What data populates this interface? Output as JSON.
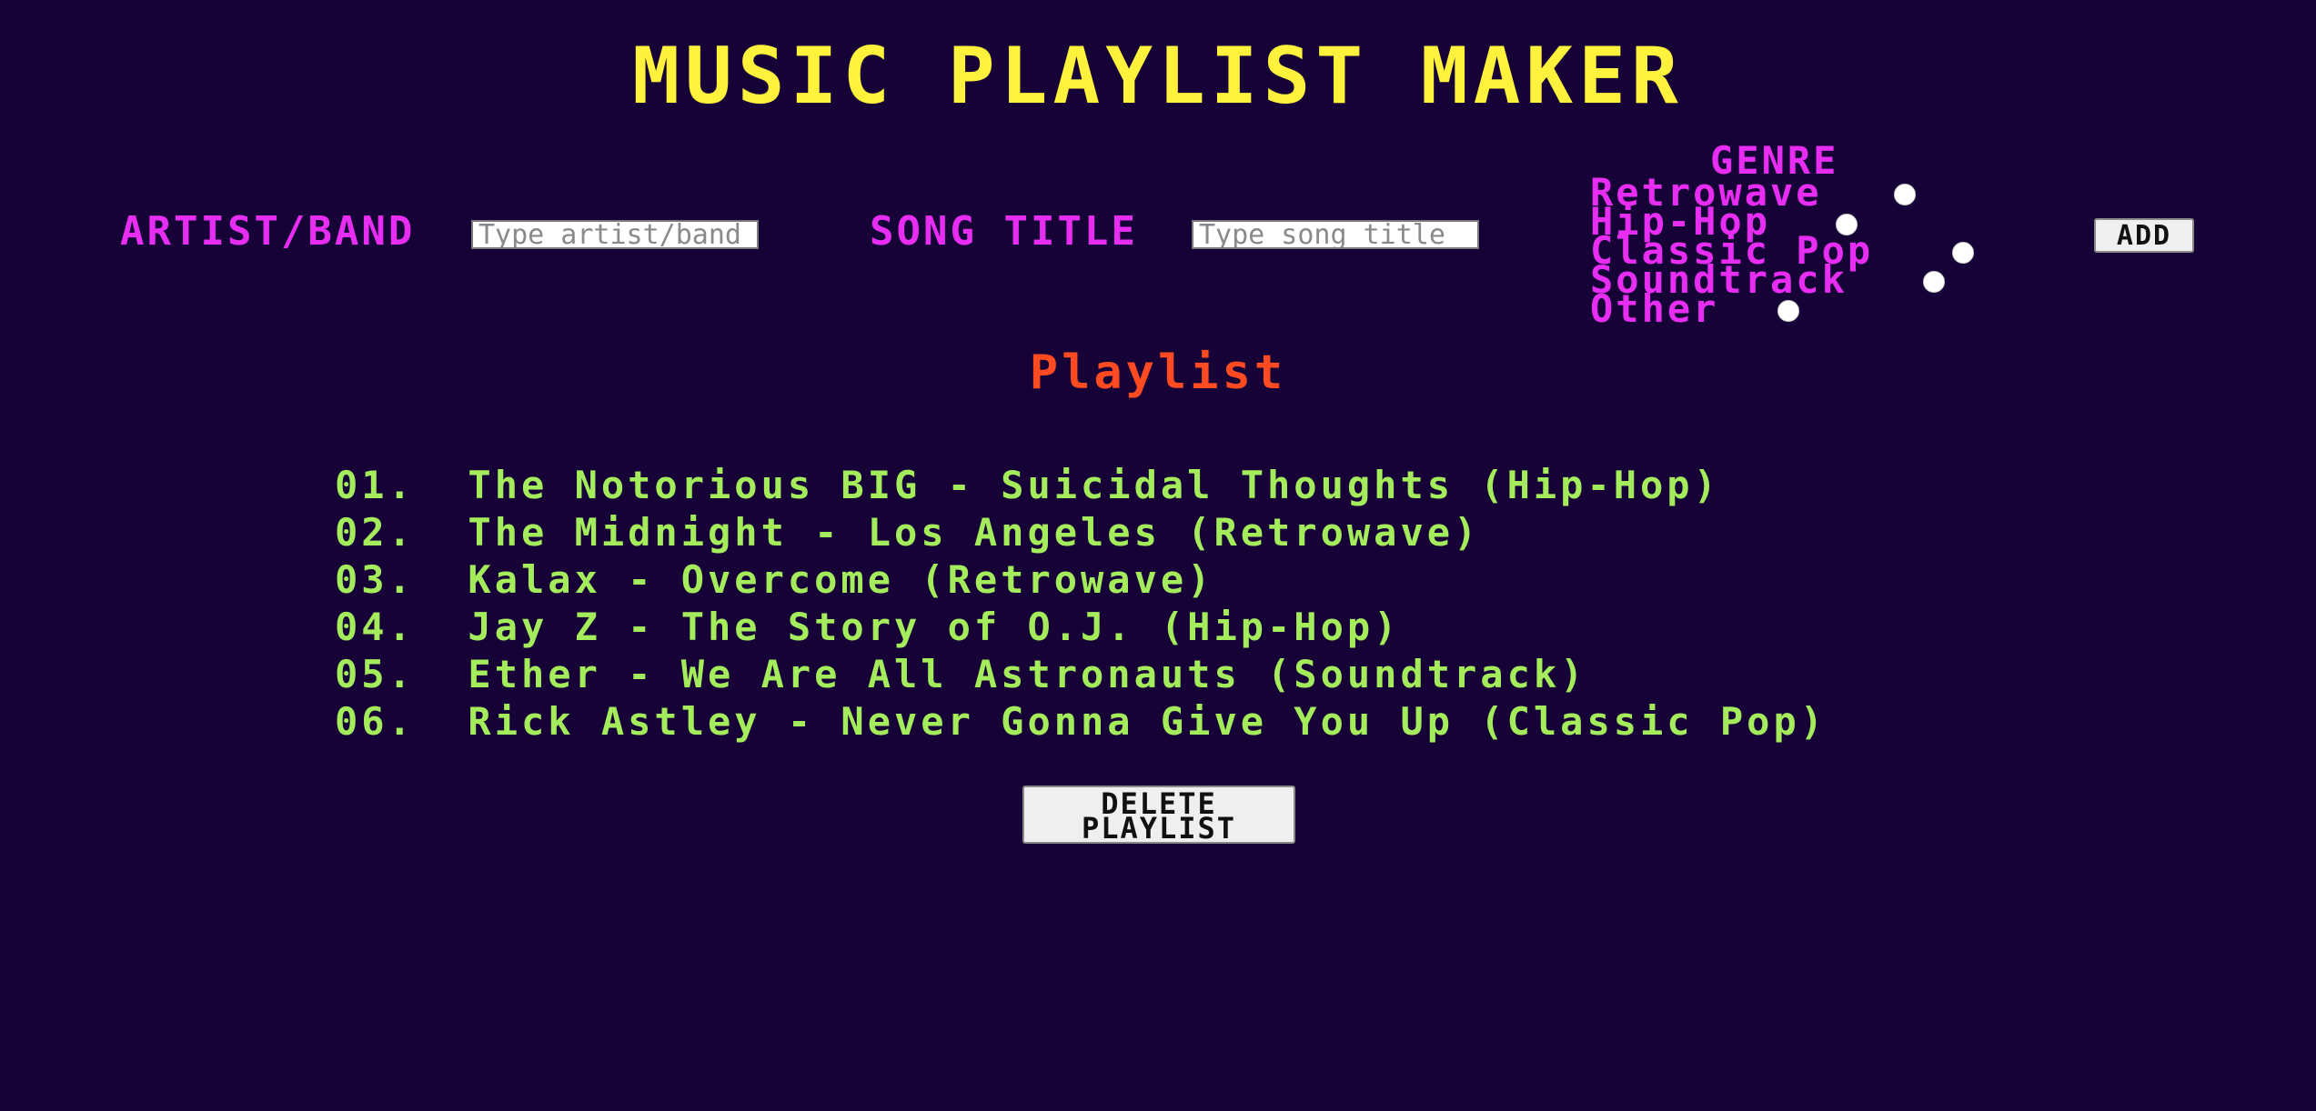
{
  "header": {
    "title": "MUSIC PLAYLIST MAKER"
  },
  "form": {
    "artist_label": "ARTIST/BAND",
    "artist_placeholder": "Type artist/band",
    "song_label": "SONG TITLE",
    "song_placeholder": "Type song title",
    "genre_heading": "GENRE",
    "genres": [
      "Retrowave",
      "Hip-Hop",
      "Classic Pop",
      "Soundtrack",
      "Other"
    ],
    "add_label": "ADD"
  },
  "playlist": {
    "heading": "Playlist",
    "items": [
      "01.  The Notorious BIG - Suicidal Thoughts (Hip-Hop)",
      "02.  The Midnight - Los Angeles (Retrowave)",
      "03.  Kalax - Overcome (Retrowave)",
      "04.  Jay Z - The Story of O.J. (Hip-Hop)",
      "05.  Ether - We Are All Astronauts (Soundtrack)",
      "06.  Rick Astley - Never Gonna Give You Up (Classic Pop)"
    ],
    "delete_label": "DELETE\nPLAYLIST"
  },
  "colors": {
    "background": "#170238",
    "title": "#fff23c",
    "labels": "#e82df2",
    "playlist_heading": "#ff4a22",
    "playlist_items": "#a4ec5b"
  }
}
